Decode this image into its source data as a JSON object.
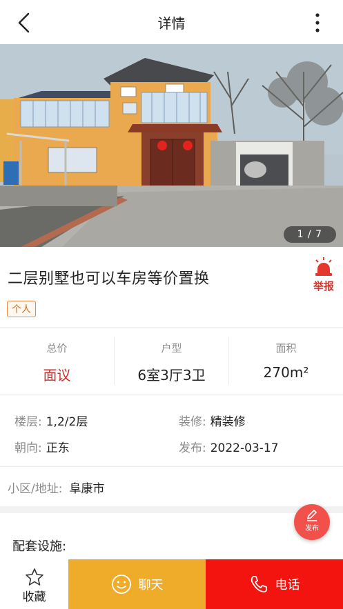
{
  "header": {
    "title": "详情",
    "back_icon": "chevron-left-icon",
    "more_icon": "more-vertical-icon"
  },
  "gallery": {
    "counter": "1 / 7"
  },
  "listing": {
    "title": "二层别墅也可以车房等价置换",
    "tag": "个人",
    "report_label": "举报"
  },
  "stats": [
    {
      "label": "总价",
      "value": "面议"
    },
    {
      "label": "户型",
      "value": "6室3厅3卫"
    },
    {
      "label": "面积",
      "value": "270m²"
    }
  ],
  "details": {
    "floor_label": "楼层:",
    "floor_value": "1,2/2层",
    "decor_label": "装修:",
    "decor_value": "精装修",
    "orient_label": "朝向:",
    "orient_value": "正东",
    "publish_label": "发布:",
    "publish_value": "2022-03-17",
    "addr_label": "小区/地址:",
    "addr_value": "阜康市"
  },
  "facilities_label": "配套设施:",
  "fab_label": "发布",
  "bottombar": {
    "fav_label": "收藏",
    "chat_label": "聊天",
    "call_label": "电话"
  },
  "colors": {
    "accent_red": "#d22d27",
    "chat_button": "#efac2a",
    "call_button": "#f3130f"
  }
}
